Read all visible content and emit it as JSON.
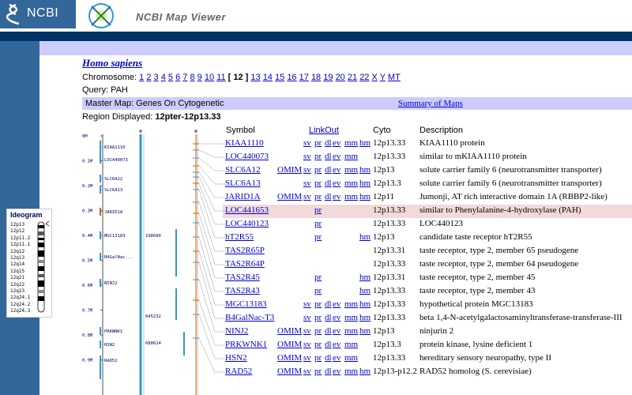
{
  "header": {
    "logo_text": "NCBI",
    "app_title": "NCBI Map Viewer"
  },
  "species": "Homo sapiens",
  "chromosome": {
    "label": "Chromosome:",
    "before": [
      "1",
      "2",
      "3",
      "4",
      "5",
      "6",
      "7",
      "8",
      "9",
      "10",
      "11"
    ],
    "current": "[ 12 ]",
    "after": [
      "13",
      "14",
      "15",
      "16",
      "17",
      "18",
      "19",
      "20",
      "21",
      "22",
      "X",
      "Y",
      "MT"
    ]
  },
  "query": "Query: PAH",
  "master_map": {
    "label": "Master Map: Genes On Cytogenetic",
    "summary_link": "Summary of Maps"
  },
  "region": {
    "label": "Region Displayed:",
    "value": "12pter-12p13.33"
  },
  "table": {
    "headers": {
      "symbol": "Symbol",
      "linkout": "LinkOut",
      "cyto": "Cyto",
      "description": "Description"
    },
    "rows": [
      {
        "symbol": "KIAA1110",
        "omim": "",
        "sv": "sv",
        "pr": "pr",
        "dl": "dl",
        "ev": "ev",
        "mm": "mm",
        "hm": "hm",
        "cyto": "12p13.33",
        "desc": "KIAA1110 protein",
        "hl": false
      },
      {
        "symbol": "LOC440073",
        "omim": "",
        "sv": "sv",
        "pr": "pr",
        "dl": "dl",
        "ev": "ev",
        "mm": "mm",
        "hm": "",
        "cyto": "12p13.33",
        "desc": "similar to mKIAA1110 protein",
        "hl": false
      },
      {
        "symbol": "SLC6A12",
        "omim": "OMIM",
        "sv": "sv",
        "pr": "pr",
        "dl": "dl",
        "ev": "ev",
        "mm": "mm",
        "hm": "hm",
        "cyto": "12p13",
        "desc": "solute carrier family 6 (neurotransmitter transporter)",
        "hl": false
      },
      {
        "symbol": "SLC6A13",
        "omim": "",
        "sv": "sv",
        "pr": "pr",
        "dl": "dl",
        "ev": "ev",
        "mm": "mm",
        "hm": "hm",
        "cyto": "12p13.3",
        "desc": "solute carrier family 6 (neurotransmitter transporter)",
        "hl": false
      },
      {
        "symbol": "JARID1A",
        "omim": "OMIM",
        "sv": "sv",
        "pr": "pr",
        "dl": "dl",
        "ev": "ev",
        "mm": "mm",
        "hm": "hm",
        "cyto": "12p11",
        "desc": "Jumonji, AT rich interactive domain 1A (RBBP2-like)",
        "hl": false
      },
      {
        "symbol": "LOC441653",
        "omim": "",
        "sv": "",
        "pr": "pr",
        "dl": "",
        "ev": "",
        "mm": "",
        "hm": "",
        "cyto": "12p13.33",
        "desc": "similar to Phenylalanine-4-hydroxylase (PAH)",
        "hl": true
      },
      {
        "symbol": "LOC440123",
        "omim": "",
        "sv": "",
        "pr": "pr",
        "dl": "",
        "ev": "",
        "mm": "",
        "hm": "",
        "cyto": "12p13.33",
        "desc": "LOC440123",
        "hl": false
      },
      {
        "symbol": "hT2R55",
        "omim": "",
        "sv": "",
        "pr": "pr",
        "dl": "",
        "ev": "",
        "mm": "",
        "hm": "hm",
        "cyto": "12p13",
        "desc": "candidate taste receptor hT2R55",
        "hl": false
      },
      {
        "symbol": "TAS2R65P",
        "omim": "",
        "sv": "",
        "pr": "",
        "dl": "",
        "ev": "",
        "mm": "",
        "hm": "",
        "cyto": "12p13.31",
        "desc": "taste receptor, type 2, member 65 pseudogene",
        "hl": false
      },
      {
        "symbol": "TAS2R64P",
        "omim": "",
        "sv": "",
        "pr": "",
        "dl": "",
        "ev": "",
        "mm": "",
        "hm": "",
        "cyto": "12p13.33",
        "desc": "taste receptor, type 2, member 64 pseudogene",
        "hl": false
      },
      {
        "symbol": "TAS2R45",
        "omim": "",
        "sv": "",
        "pr": "pr",
        "dl": "",
        "ev": "",
        "mm": "",
        "hm": "hm",
        "cyto": "12p13.31",
        "desc": "taste receptor, type 2, member 45",
        "hl": false
      },
      {
        "symbol": "TAS2R43",
        "omim": "",
        "sv": "",
        "pr": "pr",
        "dl": "",
        "ev": "",
        "mm": "",
        "hm": "hm",
        "cyto": "12p13.33",
        "desc": "taste receptor, type 2, member 43",
        "hl": false
      },
      {
        "symbol": "MGC13183",
        "omim": "",
        "sv": "sv",
        "pr": "pr",
        "dl": "dl",
        "ev": "ev",
        "mm": "mm",
        "hm": "hm",
        "cyto": "12p13.33",
        "desc": "hypothetical protein MGC13183",
        "hl": false
      },
      {
        "symbol": "B4GalNac-T3",
        "omim": "",
        "sv": "sv",
        "pr": "pr",
        "dl": "dl",
        "ev": "ev",
        "mm": "mm",
        "hm": "hm",
        "cyto": "12p13.33",
        "desc": "beta 1,4-N-acetylgalactosaminyltransferase-transferase-III",
        "hl": false
      },
      {
        "symbol": "NINJ2",
        "omim": "OMIM",
        "sv": "sv",
        "pr": "pr",
        "dl": "dl",
        "ev": "ev",
        "mm": "mm",
        "hm": "hm",
        "cyto": "12p13",
        "desc": "ninjurin 2",
        "hl": false
      },
      {
        "symbol": "PRKWNK1",
        "omim": "OMIM",
        "sv": "sv",
        "pr": "pr",
        "dl": "dl",
        "ev": "ev",
        "mm": "mm",
        "hm": "",
        "cyto": "12p13.3",
        "desc": "protein kinase, lysine deficient 1",
        "hl": false
      },
      {
        "symbol": "HSN2",
        "omim": "OMIM",
        "sv": "sv",
        "pr": "pr",
        "dl": "dl",
        "ev": "ev",
        "mm": "mm",
        "hm": "",
        "cyto": "12p13.33",
        "desc": "hereditary sensory neuropathy, type II",
        "hl": false
      },
      {
        "symbol": "RAD52",
        "omim": "OMIM",
        "sv": "sv",
        "pr": "pr",
        "dl": "dl",
        "ev": "ev",
        "mm": "mm",
        "hm": "hm",
        "cyto": "12p13-p12.2",
        "desc": "RAD52 homolog (S. cerevisiae)",
        "hl": false
      }
    ]
  },
  "ideogram": {
    "title": "Ideogram",
    "bands": [
      "12p13",
      "12p12",
      "12p11.2",
      "12p11.1",
      "12q12",
      "12q13",
      "12q14",
      "12q15",
      "12q21",
      "12q22",
      "12q23",
      "12q24.1",
      "12q24.2",
      "12q24.3"
    ]
  },
  "map": {
    "ruler_ticks": [
      "0M",
      "0.1M",
      "0.2M",
      "0.3M",
      "0.4M",
      "0.5M",
      "0.6M",
      "0.7M",
      "0.8M",
      "0.9M"
    ],
    "gene_labels": [
      "KIAA1110",
      "LOC440073",
      "SLC6A12",
      "SLC6A13",
      "JARID1A",
      "MGC13183",
      "B4GalNac...",
      "NINJ2",
      "PRKWNK1",
      "HSN2",
      "RAD52"
    ],
    "contig_labels": [
      "198680",
      "645232",
      "688624"
    ]
  },
  "colors": {
    "header_blue": "#336699",
    "dark_bar": "#003366",
    "lavender": "#ccccff",
    "highlight": "#f2dada",
    "link": "#0000cc"
  }
}
